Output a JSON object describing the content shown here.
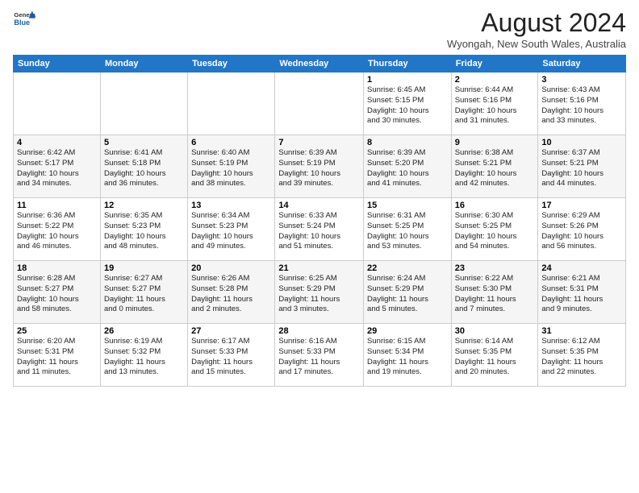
{
  "logo": {
    "general": "General",
    "blue": "Blue"
  },
  "title": "August 2024",
  "location": "Wyongah, New South Wales, Australia",
  "days_of_week": [
    "Sunday",
    "Monday",
    "Tuesday",
    "Wednesday",
    "Thursday",
    "Friday",
    "Saturday"
  ],
  "weeks": [
    [
      {
        "day": "",
        "info": ""
      },
      {
        "day": "",
        "info": ""
      },
      {
        "day": "",
        "info": ""
      },
      {
        "day": "",
        "info": ""
      },
      {
        "day": "1",
        "info": "Sunrise: 6:45 AM\nSunset: 5:15 PM\nDaylight: 10 hours\nand 30 minutes."
      },
      {
        "day": "2",
        "info": "Sunrise: 6:44 AM\nSunset: 5:16 PM\nDaylight: 10 hours\nand 31 minutes."
      },
      {
        "day": "3",
        "info": "Sunrise: 6:43 AM\nSunset: 5:16 PM\nDaylight: 10 hours\nand 33 minutes."
      }
    ],
    [
      {
        "day": "4",
        "info": "Sunrise: 6:42 AM\nSunset: 5:17 PM\nDaylight: 10 hours\nand 34 minutes."
      },
      {
        "day": "5",
        "info": "Sunrise: 6:41 AM\nSunset: 5:18 PM\nDaylight: 10 hours\nand 36 minutes."
      },
      {
        "day": "6",
        "info": "Sunrise: 6:40 AM\nSunset: 5:19 PM\nDaylight: 10 hours\nand 38 minutes."
      },
      {
        "day": "7",
        "info": "Sunrise: 6:39 AM\nSunset: 5:19 PM\nDaylight: 10 hours\nand 39 minutes."
      },
      {
        "day": "8",
        "info": "Sunrise: 6:39 AM\nSunset: 5:20 PM\nDaylight: 10 hours\nand 41 minutes."
      },
      {
        "day": "9",
        "info": "Sunrise: 6:38 AM\nSunset: 5:21 PM\nDaylight: 10 hours\nand 42 minutes."
      },
      {
        "day": "10",
        "info": "Sunrise: 6:37 AM\nSunset: 5:21 PM\nDaylight: 10 hours\nand 44 minutes."
      }
    ],
    [
      {
        "day": "11",
        "info": "Sunrise: 6:36 AM\nSunset: 5:22 PM\nDaylight: 10 hours\nand 46 minutes."
      },
      {
        "day": "12",
        "info": "Sunrise: 6:35 AM\nSunset: 5:23 PM\nDaylight: 10 hours\nand 48 minutes."
      },
      {
        "day": "13",
        "info": "Sunrise: 6:34 AM\nSunset: 5:23 PM\nDaylight: 10 hours\nand 49 minutes."
      },
      {
        "day": "14",
        "info": "Sunrise: 6:33 AM\nSunset: 5:24 PM\nDaylight: 10 hours\nand 51 minutes."
      },
      {
        "day": "15",
        "info": "Sunrise: 6:31 AM\nSunset: 5:25 PM\nDaylight: 10 hours\nand 53 minutes."
      },
      {
        "day": "16",
        "info": "Sunrise: 6:30 AM\nSunset: 5:25 PM\nDaylight: 10 hours\nand 54 minutes."
      },
      {
        "day": "17",
        "info": "Sunrise: 6:29 AM\nSunset: 5:26 PM\nDaylight: 10 hours\nand 56 minutes."
      }
    ],
    [
      {
        "day": "18",
        "info": "Sunrise: 6:28 AM\nSunset: 5:27 PM\nDaylight: 10 hours\nand 58 minutes."
      },
      {
        "day": "19",
        "info": "Sunrise: 6:27 AM\nSunset: 5:27 PM\nDaylight: 11 hours\nand 0 minutes."
      },
      {
        "day": "20",
        "info": "Sunrise: 6:26 AM\nSunset: 5:28 PM\nDaylight: 11 hours\nand 2 minutes."
      },
      {
        "day": "21",
        "info": "Sunrise: 6:25 AM\nSunset: 5:29 PM\nDaylight: 11 hours\nand 3 minutes."
      },
      {
        "day": "22",
        "info": "Sunrise: 6:24 AM\nSunset: 5:29 PM\nDaylight: 11 hours\nand 5 minutes."
      },
      {
        "day": "23",
        "info": "Sunrise: 6:22 AM\nSunset: 5:30 PM\nDaylight: 11 hours\nand 7 minutes."
      },
      {
        "day": "24",
        "info": "Sunrise: 6:21 AM\nSunset: 5:31 PM\nDaylight: 11 hours\nand 9 minutes."
      }
    ],
    [
      {
        "day": "25",
        "info": "Sunrise: 6:20 AM\nSunset: 5:31 PM\nDaylight: 11 hours\nand 11 minutes."
      },
      {
        "day": "26",
        "info": "Sunrise: 6:19 AM\nSunset: 5:32 PM\nDaylight: 11 hours\nand 13 minutes."
      },
      {
        "day": "27",
        "info": "Sunrise: 6:17 AM\nSunset: 5:33 PM\nDaylight: 11 hours\nand 15 minutes."
      },
      {
        "day": "28",
        "info": "Sunrise: 6:16 AM\nSunset: 5:33 PM\nDaylight: 11 hours\nand 17 minutes."
      },
      {
        "day": "29",
        "info": "Sunrise: 6:15 AM\nSunset: 5:34 PM\nDaylight: 11 hours\nand 19 minutes."
      },
      {
        "day": "30",
        "info": "Sunrise: 6:14 AM\nSunset: 5:35 PM\nDaylight: 11 hours\nand 20 minutes."
      },
      {
        "day": "31",
        "info": "Sunrise: 6:12 AM\nSunset: 5:35 PM\nDaylight: 11 hours\nand 22 minutes."
      }
    ]
  ]
}
